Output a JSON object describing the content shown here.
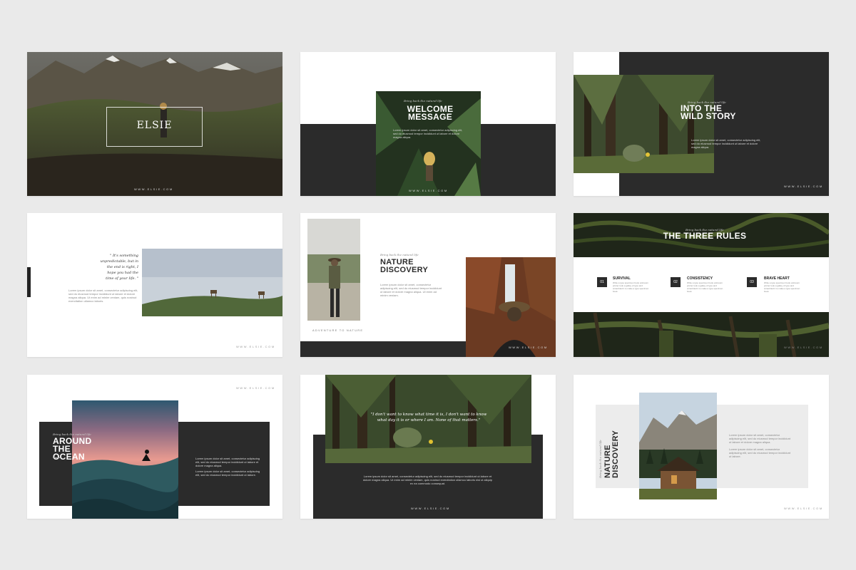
{
  "slides": {
    "s1": {
      "title": "ELSIE",
      "url": "WWW.ELSIE.COM"
    },
    "s2": {
      "kicker": "Bring back the natural life",
      "title": "WELCOME MESSAGE",
      "body": "Lorem ipsum dolor sit amet, consectetur adipiscing elit, sed do eiusmod tempor incididunt ut labore et dolore magna aliqua.",
      "url": "WWW.ELSIE.COM"
    },
    "s3": {
      "kicker": "Bring back the natural life",
      "title": "INTO THE WILD STORY",
      "body": "Lorem ipsum dolor sit amet, consectetur adipiscing elit, sed do eiusmod tempor incididunt ut labore et dolore magna aliqua.",
      "url": "WWW.ELSIE.COM"
    },
    "s4": {
      "quote": "\" It's something unpredictable, but in the end is right, I hope you had the time of your life. \"",
      "body": "Lorem ipsum dolor sit amet, consectetur adipiscing elit, sed do eiusmod tempor incididunt ut labore et dolore magna aliqua. Ut enim ad minim veniam, quis nostrud exercitation ullamco laboris.",
      "url": "WWW.ELSIE.COM"
    },
    "s5": {
      "kicker": "Bring back the natural life",
      "title": "NATURE DISCOVERY",
      "body": "Lorem ipsum dolor sit amet, consectetur adipiscing elit, sed do eiusmod tempor incididunt ut labore et dolore magna aliqua. Ut enim ad minim veniam.",
      "caption": "ADVENTURE TO NATURE",
      "url": "WWW.ELSIE.COM"
    },
    "s6": {
      "kicker": "Bring back the natural life",
      "title": "THE THREE RULES",
      "rules": [
        {
          "num": "01",
          "name": "SURVIVAL",
          "text": "Write a type specimen book unknown printer took a galley of type and scrambled it to make a type specimen book."
        },
        {
          "num": "02",
          "name": "CONSISTENCY",
          "text": "Write a type specimen book unknown printer took a galley of type and scrambled it to make a type specimen book."
        },
        {
          "num": "03",
          "name": "BRAVE HEART",
          "text": "Write a type specimen book unknown printer took a galley of type and scrambled it to make a type specimen book."
        }
      ],
      "url": "WWW.ELSIE.COM"
    },
    "s7": {
      "kicker": "Bring back the natural life",
      "title": "AROUND THE OCEAN",
      "body1": "Lorem ipsum dolor sit amet, consectetur adipiscing elit, sed do eiusmod tempor incididunt ut labore et dolore magna aliqua.",
      "body2": "Lorem ipsum dolor sit amet, consectetur adipiscing elit, sed do eiusmod tempor incididunt ut labore.",
      "url": "WWW.ELSIE.COM"
    },
    "s8": {
      "quote": "\"I don't want to know what time it is, I don't want to know what day it is or where I am. None of that matters.\"",
      "body": "Lorem ipsum dolor sit amet, consectetur adipiscing elit, sed do eiusmod tempor incididunt ut labore et dolore magna aliqua. Ut enim ad minim veniam, quis nostrud exercitation ullamco laboris nisi ut aliquip ex ea commodo consequat.",
      "url": "WWW.ELSIE.COM"
    },
    "s9": {
      "kicker": "Bring back the natural life",
      "title": "NATURE DISCOVERY",
      "body1": "Lorem ipsum dolor sit amet, consectetur adipiscing elit, sed do eiusmod tempor incididunt ut labore et dolore magna aliqua.",
      "body2": "Lorem ipsum dolor sit amet, consectetur adipiscing elit, sed do eiusmod tempor incididunt ut labore.",
      "url": "WWW.ELSIE.COM"
    }
  }
}
